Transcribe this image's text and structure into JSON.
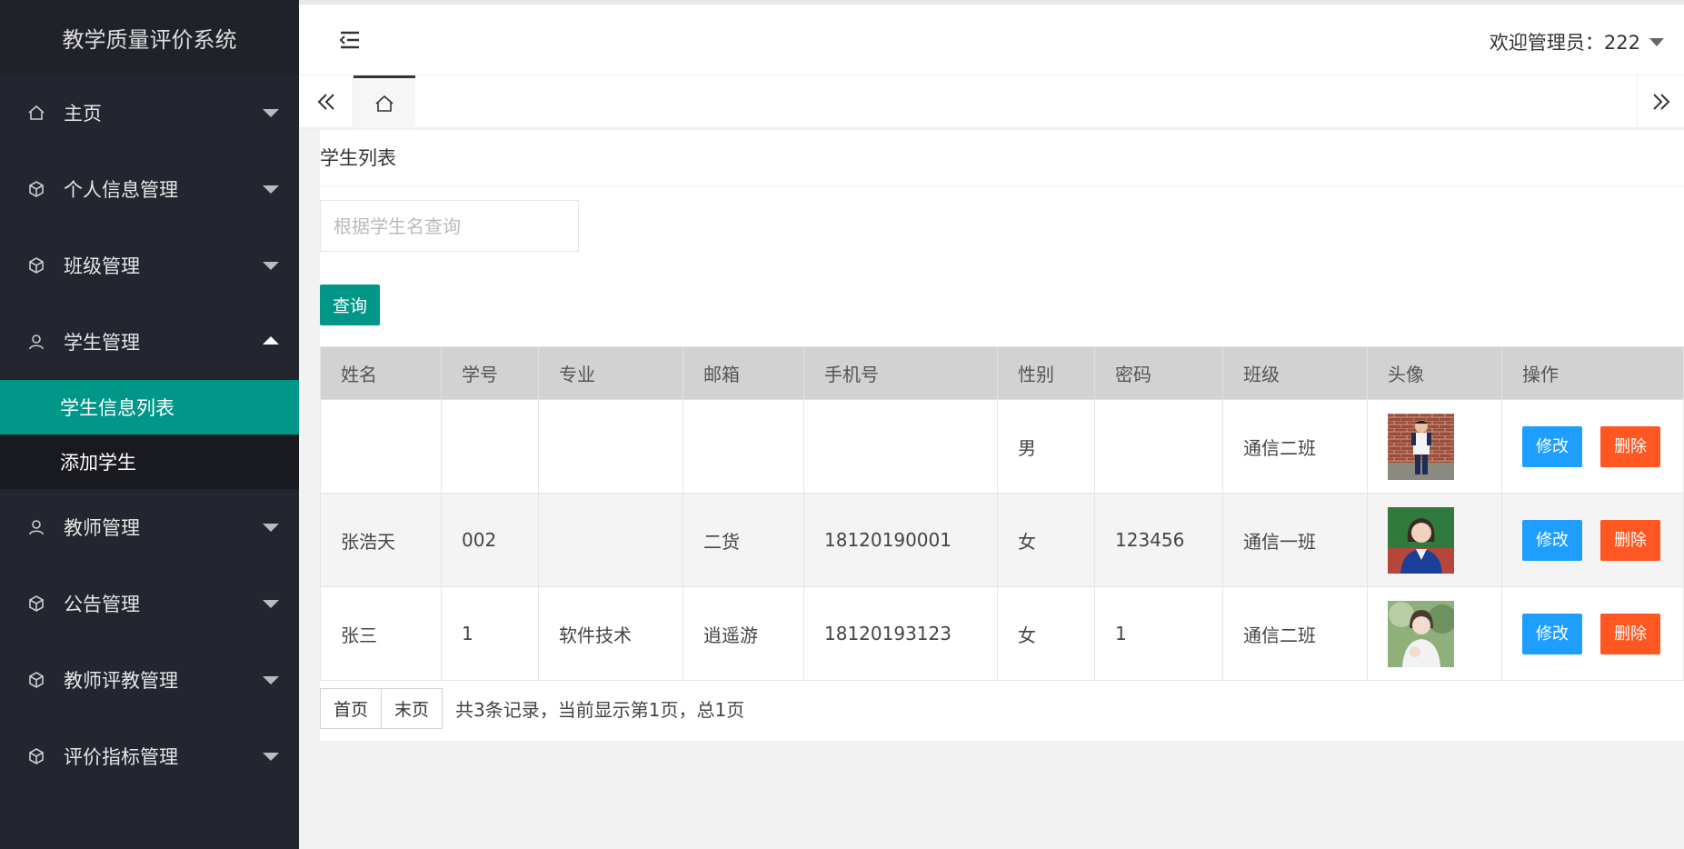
{
  "sidebar": {
    "logo": "教学质量评价系统",
    "items": [
      {
        "label": "主页",
        "icon": "home-icon"
      },
      {
        "label": "个人信息管理",
        "icon": "cube-icon"
      },
      {
        "label": "班级管理",
        "icon": "cube-icon"
      },
      {
        "label": "学生管理",
        "icon": "user-icon",
        "expanded": true
      },
      {
        "label": "教师管理",
        "icon": "user-icon"
      },
      {
        "label": "公告管理",
        "icon": "cube-icon"
      },
      {
        "label": "教师评教管理",
        "icon": "cube-icon"
      },
      {
        "label": "评价指标管理",
        "icon": "cube-icon"
      }
    ],
    "sub_items": [
      {
        "label": "学生信息列表",
        "active": true
      },
      {
        "label": "添加学生"
      }
    ]
  },
  "header": {
    "welcome": "欢迎管理员：222"
  },
  "content": {
    "title": "学生列表",
    "search_placeholder": "根据学生名查询",
    "search_value": "",
    "search_button": "查询",
    "columns": [
      "姓名",
      "学号",
      "专业",
      "邮箱",
      "手机号",
      "性别",
      "密码",
      "班级",
      "头像",
      "操作"
    ],
    "rows": [
      {
        "name": "",
        "id": "",
        "major": "",
        "email": "",
        "phone": "",
        "gender": "男",
        "password": "",
        "class": "通信二班",
        "avatar": "avatar-boy"
      },
      {
        "name": "张浩天",
        "id": "002",
        "major": "",
        "email": "二货",
        "phone": "18120190001",
        "gender": "女",
        "password": "123456",
        "class": "通信一班",
        "avatar": "avatar-girl"
      },
      {
        "name": "张三",
        "id": "1",
        "major": "软件技术",
        "email": "逍遥游",
        "phone": "18120193123",
        "gender": "女",
        "password": "1",
        "class": "通信二班",
        "avatar": "avatar-girl-2"
      }
    ],
    "edit_label": "修改",
    "delete_label": "删除",
    "pager": {
      "first": "首页",
      "last": "末页",
      "summary": "共3条记录，当前显示第1页，总1页"
    }
  },
  "colors": {
    "sidebar_bg": "#23262e",
    "active": "#009688",
    "edit": "#1e9fff",
    "delete": "#ff5722"
  }
}
